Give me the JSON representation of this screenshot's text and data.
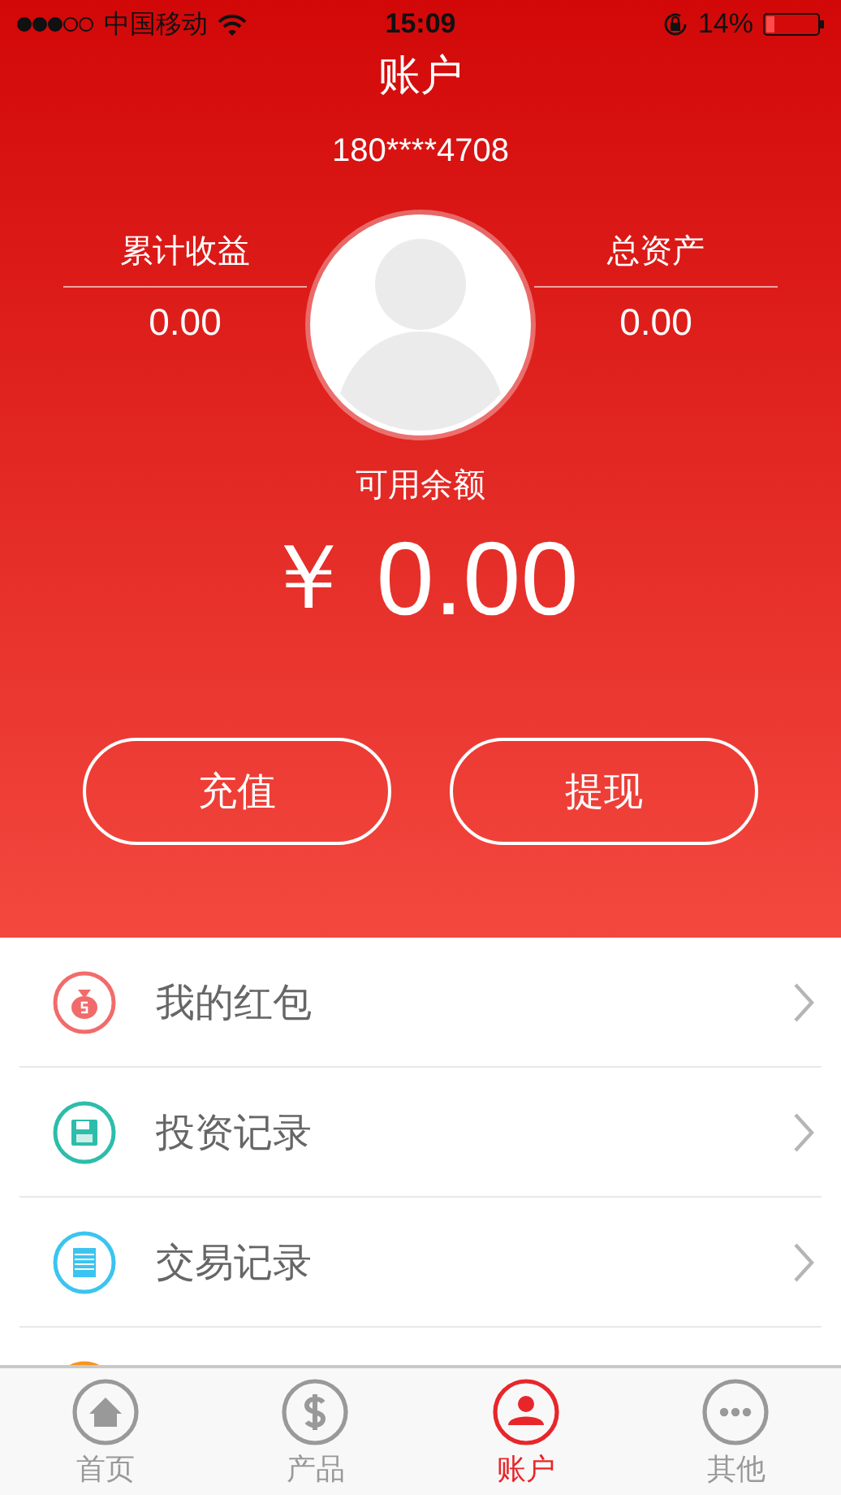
{
  "status_bar": {
    "carrier": "中国移动",
    "time": "15:09",
    "battery": "14%"
  },
  "title": "账户",
  "phone": "180****4708",
  "stats": [
    {
      "label": "累计收益",
      "value": "0.00"
    },
    {
      "label": "总资产",
      "value": "0.00"
    }
  ],
  "balance": {
    "label": "可用余额",
    "currency": "￥",
    "amount": "0.00"
  },
  "buttons": [
    "充值",
    "提现"
  ],
  "menu": [
    {
      "kind": "money-bag",
      "label": "我的红包",
      "color": "#f26b6b"
    },
    {
      "kind": "floppy",
      "label": "投资记录",
      "color": "#2dbdaa"
    },
    {
      "kind": "notepad",
      "label": "交易记录",
      "color": "#3cc4f0"
    },
    {
      "kind": "partial",
      "color": "#f7941d"
    }
  ],
  "tabs": [
    {
      "kind": "home",
      "label": "首页",
      "selected": false
    },
    {
      "kind": "dollar",
      "label": "产品",
      "selected": false
    },
    {
      "kind": "user",
      "label": "账户",
      "selected": true
    },
    {
      "kind": "more",
      "label": "其他",
      "selected": false
    }
  ]
}
